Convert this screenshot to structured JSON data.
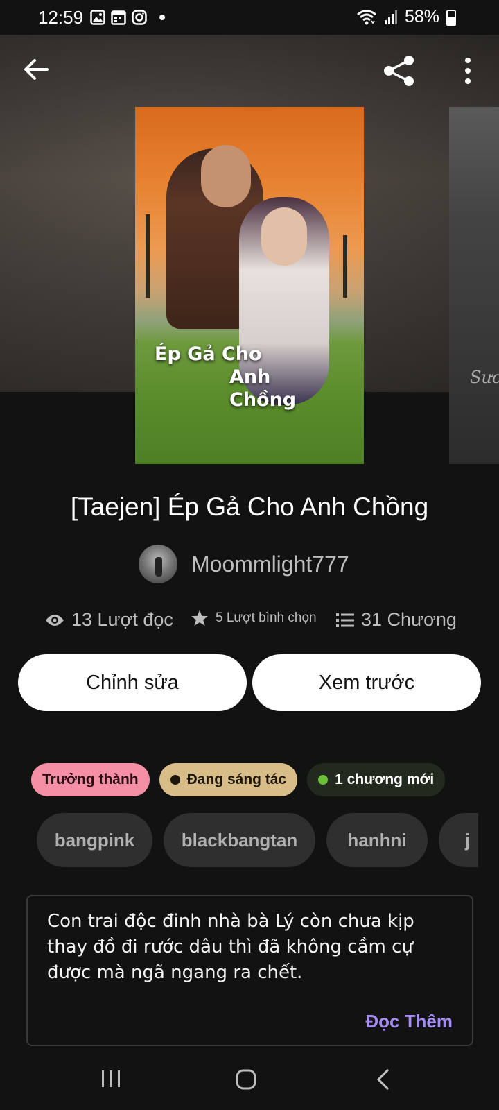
{
  "status_bar": {
    "time": "12:59",
    "battery": "58%",
    "battery_level": 0.58,
    "icons_left": [
      "gallery-icon",
      "calendar-icon",
      "instagram-icon",
      "dot-icon"
    ],
    "icons_right": [
      "wifi-icon",
      "signal-icon",
      "battery-icon"
    ]
  },
  "header": {
    "icons": [
      "back-arrow-icon",
      "share-icon",
      "more-vert-icon"
    ]
  },
  "cover": {
    "title_line1": "Ép Gả Cho",
    "title_line2": "Anh Chồng",
    "next_cover_text": "Sưc"
  },
  "story": {
    "title": "[Taejen] Ép Gả Cho Anh Chồng",
    "author": "Moommlight777"
  },
  "stats": {
    "reads": "13 Lượt đọc",
    "votes": "5 Lượt bình chọn",
    "parts": "31 Chương"
  },
  "actions": {
    "edit_label": "Chỉnh sửa",
    "preview_label": "Xem trước"
  },
  "badges": {
    "mature": "Trưởng thành",
    "ongoing": "Đang sáng tác",
    "new_parts": "1 chương mới"
  },
  "tags": [
    "bangpink",
    "blackbangtan",
    "hanhni",
    "j"
  ],
  "description": {
    "text": "Con trai độc đinh nhà bà Lý còn chưa kịp thay đồ đi rước dâu thì đã không cầm cự được mà ngã ngang ra chết.",
    "read_more": "Đọc Thêm"
  },
  "colors": {
    "background": "#121212",
    "mature_badge": "#f58fa6",
    "ongoing_badge": "#d9bd88",
    "new_dot": "#6bbf3a",
    "read_more": "#a58cf6"
  }
}
